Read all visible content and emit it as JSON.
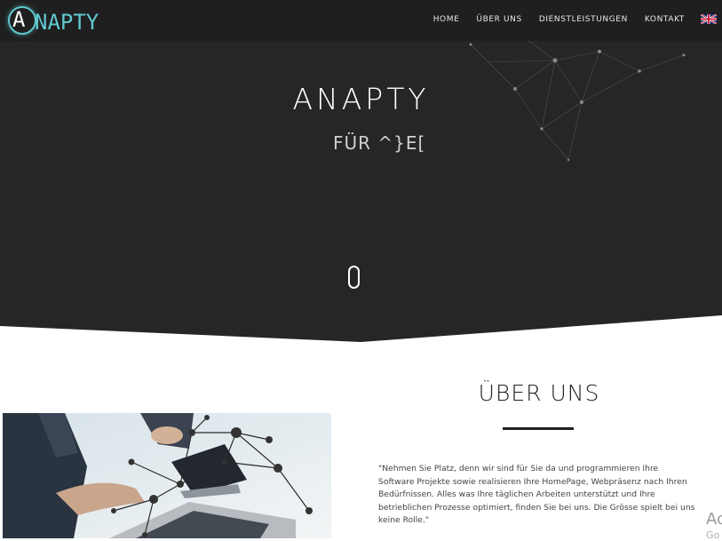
{
  "brand": {
    "logo_letter": "A",
    "logo_text": "NAPTY",
    "accent_color": "#5fc9d0"
  },
  "nav": {
    "items": [
      "HOME",
      "ÜBER UNS",
      "DIENSTLEISTUNGEN",
      "KONTAKT"
    ],
    "language_icon": "uk-flag-icon"
  },
  "hero": {
    "title": "ANAPTY",
    "subtitle": "FÜR ^}E[",
    "scroll_icon": "mouse-scroll-icon",
    "background_color": "#262626"
  },
  "about": {
    "title": "ÜBER UNS",
    "text": "\"Nehmen Sie Platz, denn wir sind für Sie da und programmieren Ihre Software Projekte sowie realisieren Ihre HomePage, Webpräsenz nach Ihren Bedürfnissen. Alles was Ihre täglichen Arbeiten unterstützt und Ihre betrieblichen Prozesse optimiert, finden Sie bei uns. Die Grösse spielt bei uns keine Rolle.\""
  },
  "watermark": {
    "line1": "Ac",
    "line2": "Go"
  }
}
